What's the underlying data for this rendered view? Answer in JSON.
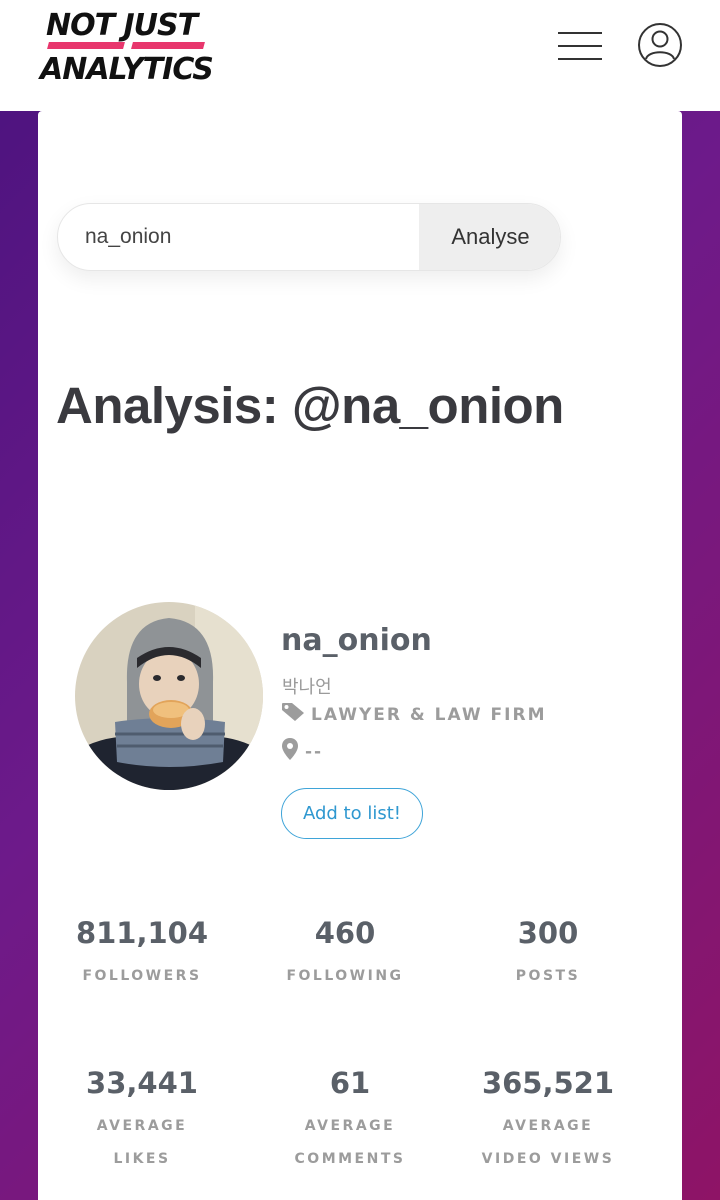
{
  "header": {
    "logo_line1": "NOT JUST",
    "logo_line2": "ANALYTICS",
    "logo_accent": "#e8366d"
  },
  "search": {
    "value": "na_onion",
    "button_label": "Analyse"
  },
  "page_title": "Analysis: @na_onion",
  "profile": {
    "username": "na_onion",
    "display_name": "박나언",
    "category": "LAWYER & LAW FIRM",
    "location": "--",
    "add_label": "Add to list!"
  },
  "stats": [
    {
      "value": "811,104",
      "label1": "FOLLOWERS",
      "label2": ""
    },
    {
      "value": "460",
      "label1": "FOLLOWING",
      "label2": ""
    },
    {
      "value": "300",
      "label1": "POSTS",
      "label2": ""
    },
    {
      "value": "33,441",
      "label1": "AVERAGE",
      "label2": "LIKES"
    },
    {
      "value": "61",
      "label1": "AVERAGE",
      "label2": "COMMENTS"
    },
    {
      "value": "365,521",
      "label1": "AVERAGE",
      "label2": "VIDEO VIEWS"
    }
  ],
  "icons": {
    "menu": "hamburger-menu-icon",
    "user": "user-account-icon",
    "category": "tag-icon",
    "location": "map-pin-icon"
  }
}
